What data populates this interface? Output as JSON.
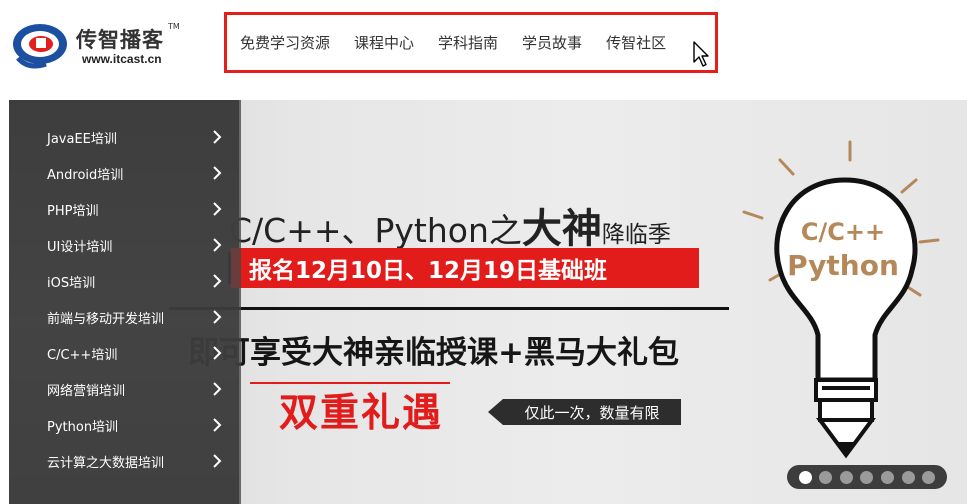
{
  "logo": {
    "name": "传智播客",
    "tm": "TM",
    "url": "www.itcast.cn"
  },
  "nav": {
    "items": [
      "免费学习资源",
      "课程中心",
      "学科指南",
      "学员故事",
      "传智社区"
    ]
  },
  "sidebar": {
    "items": [
      "JavaEE培训",
      "Android培训",
      "PHP培训",
      "UI设计培训",
      "iOS培训",
      "前端与移动开发培训",
      "C/C++培训",
      "网络营销培训",
      "Python培训",
      "云计算之大数据培训"
    ]
  },
  "banner": {
    "title_prefix": "C/C++、Python之",
    "title_big1": "大",
    "title_big2": "神",
    "title_suffix": "降临季",
    "red_bar": "报名12月10日、12月19日基础班",
    "main": "即可享受大神亲临授课+黑马大礼包",
    "double": "双重礼遇",
    "tag": "仅此一次，数量有限",
    "bulb_line1": "C/C++",
    "bulb_line2": "Python"
  },
  "carousel": {
    "count": 7,
    "active_index": 0
  },
  "colors": {
    "nav_highlight": "#e41d1d",
    "promo_red": "#e21b1b",
    "sidebar_bg": "#464646",
    "logo_blue": "#1c4fa0"
  }
}
